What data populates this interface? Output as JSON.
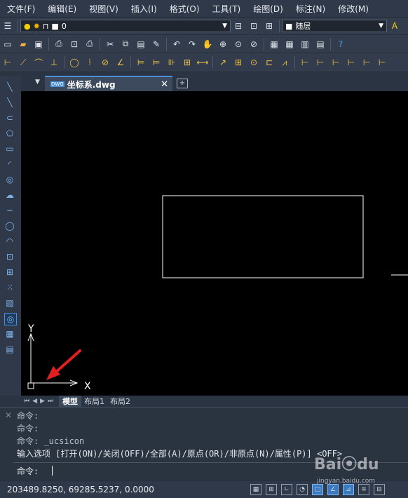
{
  "menu": [
    "文件(F)",
    "编辑(E)",
    "视图(V)",
    "插入(I)",
    "格式(O)",
    "工具(T)",
    "绘图(D)",
    "标注(N)",
    "修改(M)"
  ],
  "layer_toolbar": {
    "current_layer": "0",
    "linetype": "随层"
  },
  "document_tab": {
    "label": "坐标系.dwg",
    "badge": "DWG"
  },
  "ucs": {
    "x_label": "X",
    "y_label": "Y"
  },
  "layout_tabs": [
    "模型",
    "布局1",
    "布局2"
  ],
  "command_history": [
    "命令:",
    "命令:",
    "命令: _ucsicon",
    "输入选项 [打开(ON)/关闭(OFF)/全部(A)/原点(OR)/非原点(N)/属性(P)] <OFF>"
  ],
  "command_prompt": "命令:",
  "status": {
    "coordinates": "203489.8250, 69285.5237, 0.0000"
  },
  "colors": {
    "accent": "#4a90d9",
    "arrow": "#e02020",
    "canvas": "#000000"
  },
  "watermark": "Bai du 经验 jingyan.baidu.com"
}
